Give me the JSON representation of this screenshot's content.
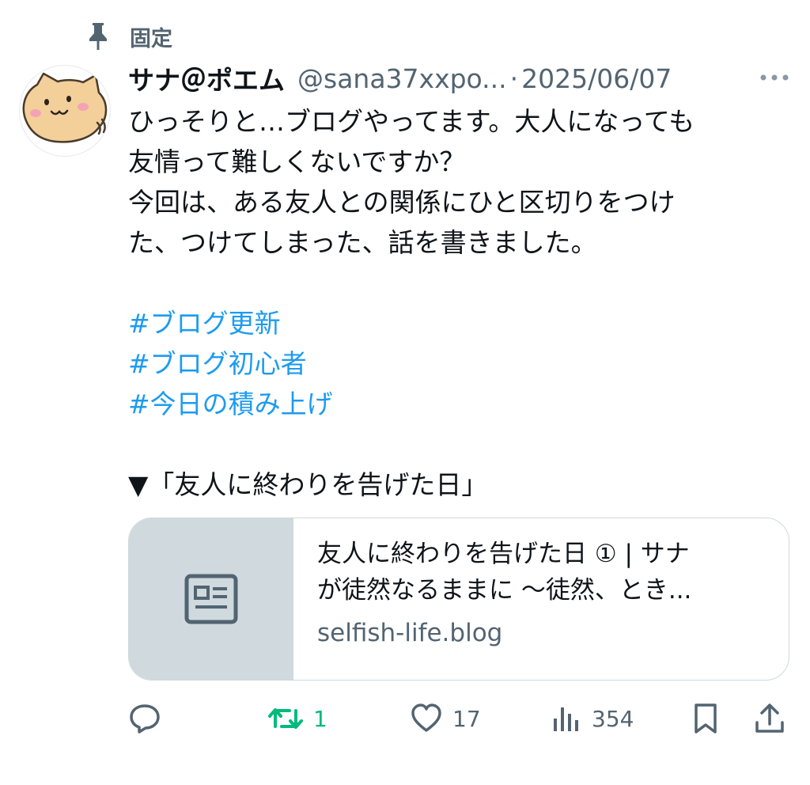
{
  "pinned": {
    "label": "固定",
    "icon": "pin-icon"
  },
  "author": {
    "display_name": "サナ＠ポエム",
    "handle": "@sana37xxpo...",
    "separator": "·",
    "date": "2025/06/07",
    "avatar": "cat-avatar"
  },
  "body": {
    "lines": [
      "ひっそりと…ブログやってます。大人になっても",
      "友情って難しくないですか？",
      "今回は、ある友人との関係にひと区切りをつけ",
      "た、つけてしまった、話を書きました。"
    ],
    "hashtags": [
      "#ブログ更新",
      "#ブログ初心者",
      "#今日の積み上げ"
    ],
    "quote_line": "▼「友人に終わりを告げた日」"
  },
  "link_card": {
    "title_line1": "友人に終わりを告げた日 ① | サナ",
    "title_line2": "が徒然なるままに 〜徒然、とき...",
    "domain": "selfish-life.blog",
    "icon": "article-icon"
  },
  "actions": {
    "reply": {
      "icon": "reply-icon",
      "count": ""
    },
    "retweet": {
      "icon": "retweet-icon",
      "count": "1",
      "active_color": "#00ba7c"
    },
    "like": {
      "icon": "heart-icon",
      "count": "17"
    },
    "views": {
      "icon": "views-icon",
      "count": "354"
    },
    "bookmark": {
      "icon": "bookmark-icon",
      "count": ""
    },
    "share": {
      "icon": "share-icon",
      "count": ""
    }
  },
  "colors": {
    "text": "#0f1419",
    "secondary": "#536471",
    "link": "#1d9bf0",
    "retweet_active": "#00ba7c",
    "card_border": "#cfd9de"
  }
}
